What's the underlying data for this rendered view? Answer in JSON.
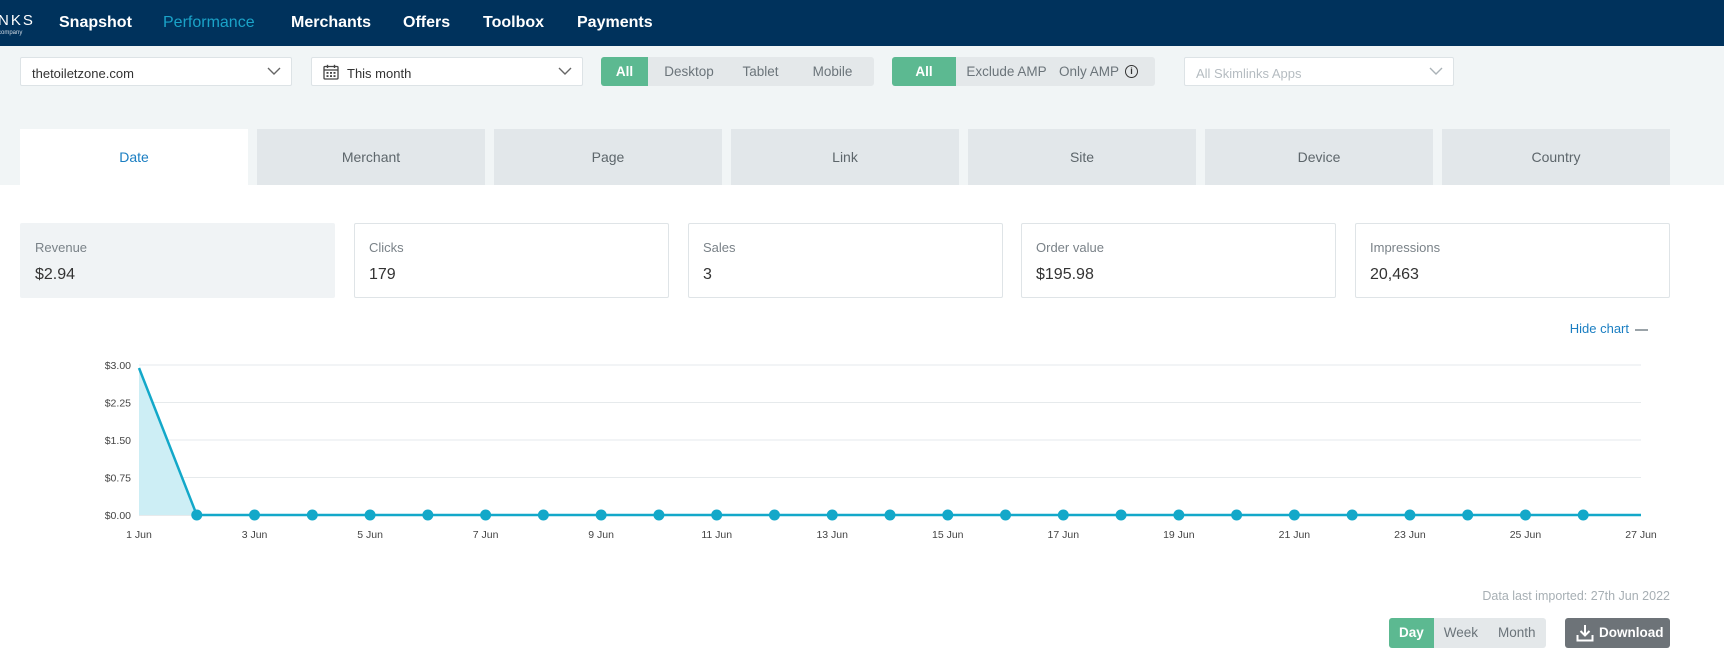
{
  "nav": {
    "brand_text": "NKS",
    "brand_sub": "company",
    "items": [
      "Snapshot",
      "Performance",
      "Merchants",
      "Offers",
      "Toolbox",
      "Payments"
    ],
    "active": "Performance"
  },
  "filters": {
    "site": "thetoiletzone.com",
    "period": "This month",
    "device_options": [
      "All",
      "Desktop",
      "Tablet",
      "Mobile"
    ],
    "device_selected": "All",
    "amp_options": [
      "All",
      "Exclude AMP",
      "Only AMP"
    ],
    "amp_selected": "All",
    "apps_placeholder": "All Skimlinks Apps"
  },
  "tabs": [
    "Date",
    "Merchant",
    "Page",
    "Link",
    "Site",
    "Device",
    "Country"
  ],
  "active_tab": "Date",
  "metrics": [
    {
      "label": "Revenue",
      "value": "$2.94",
      "selected": true
    },
    {
      "label": "Clicks",
      "value": "179"
    },
    {
      "label": "Sales",
      "value": "3"
    },
    {
      "label": "Order value",
      "value": "$195.98"
    },
    {
      "label": "Impressions",
      "value": "20,463"
    }
  ],
  "hide_chart_label": "Hide chart",
  "chart_data": {
    "type": "area",
    "x_tick_labels": [
      "1 Jun",
      "3 Jun",
      "5 Jun",
      "7 Jun",
      "9 Jun",
      "11 Jun",
      "13 Jun",
      "15 Jun",
      "17 Jun",
      "19 Jun",
      "21 Jun",
      "23 Jun",
      "25 Jun",
      "27 Jun"
    ],
    "y_tick_labels": [
      "$0.00",
      "$0.75",
      "$1.50",
      "$2.25",
      "$3.00"
    ],
    "y_ticks": [
      0,
      0.75,
      1.5,
      2.25,
      3.0
    ],
    "ylim": [
      0,
      3.0
    ],
    "xlim": [
      1,
      27
    ],
    "x": [
      1,
      2,
      3,
      4,
      5,
      6,
      7,
      8,
      9,
      10,
      11,
      12,
      13,
      14,
      15,
      16,
      17,
      18,
      19,
      20,
      21,
      22,
      23,
      24,
      25,
      26,
      27
    ],
    "values": [
      2.94,
      0,
      0,
      0,
      0,
      0,
      0,
      0,
      0,
      0,
      0,
      0,
      0,
      0,
      0,
      0,
      0,
      0,
      0,
      0,
      0,
      0,
      0,
      0,
      0,
      0,
      0
    ],
    "grid": true,
    "line_color": "#13a8c9",
    "fill_color": "#cdeef5"
  },
  "footer": {
    "imported": "Data last imported: 27th Jun 2022",
    "granularity_options": [
      "Day",
      "Week",
      "Month"
    ],
    "granularity_selected": "Day",
    "download_label": "Download"
  },
  "colors": {
    "nav_bg": "#00325c",
    "accent": "#1aa3c8",
    "selected_green": "#5cb991",
    "link_blue": "#1a7ec2"
  }
}
